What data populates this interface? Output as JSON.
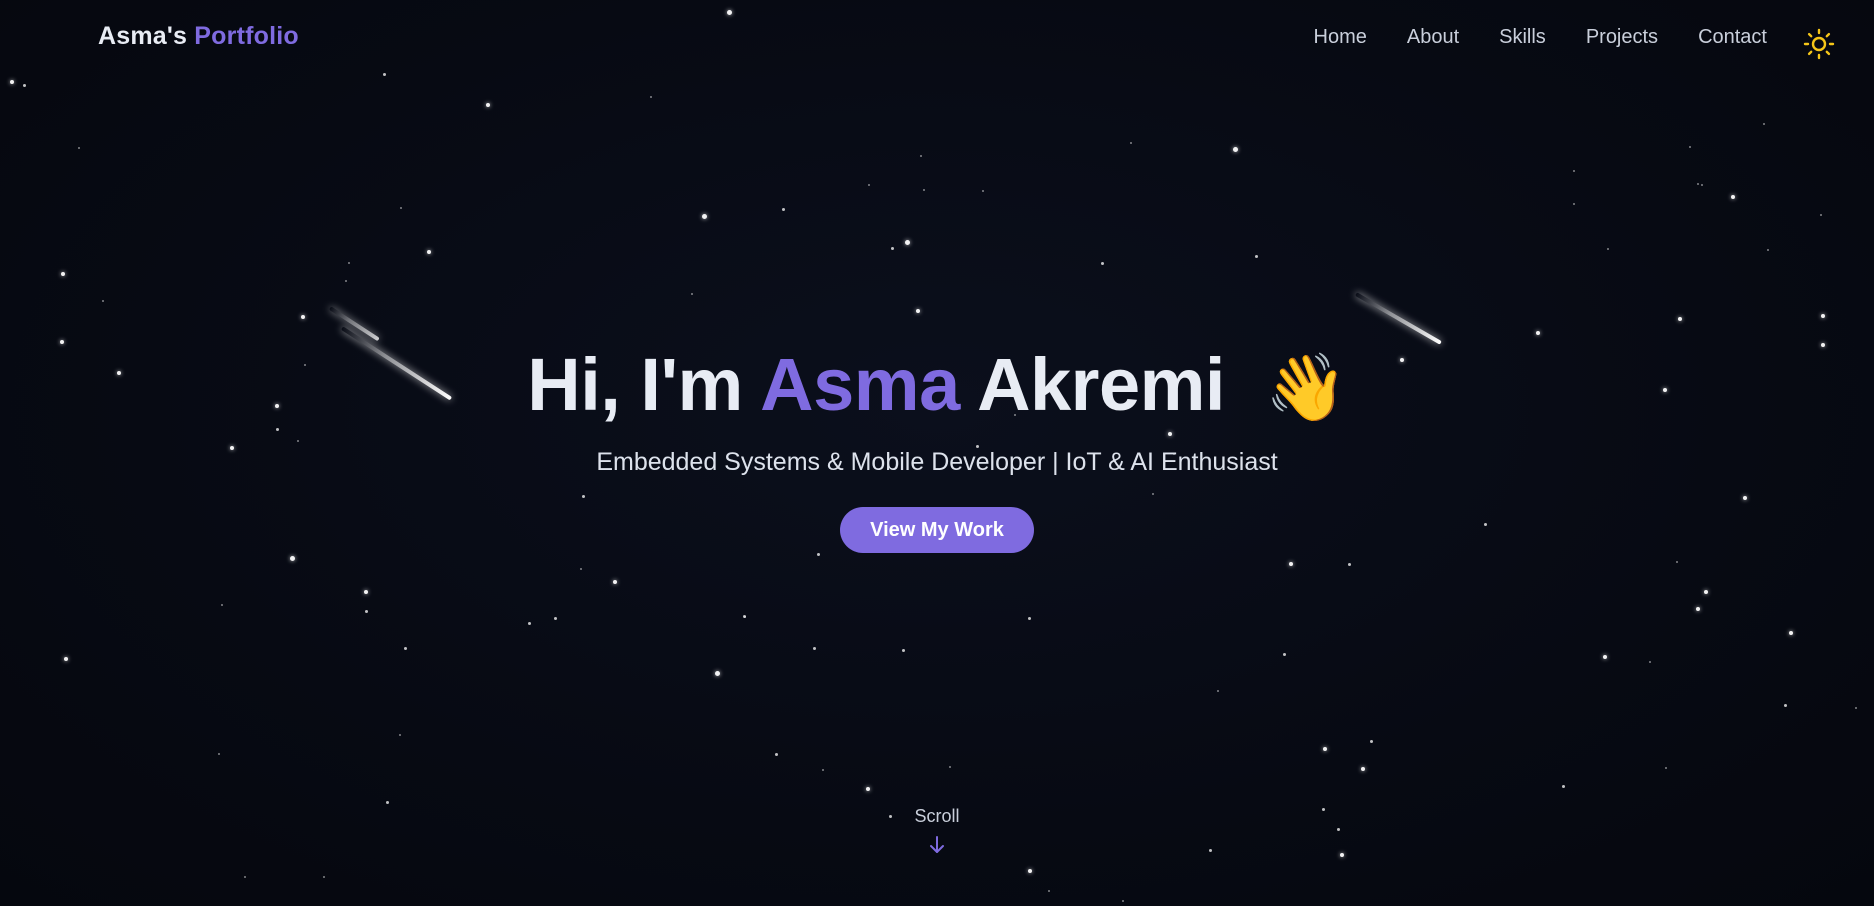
{
  "nav": {
    "brand_name": "Asma's",
    "brand_accent": "Portfolio",
    "links": [
      "Home",
      "About",
      "Skills",
      "Projects",
      "Contact"
    ],
    "theme_icon": "sun-icon"
  },
  "hero": {
    "greeting": "Hi, I'm",
    "first_name": "Asma",
    "last_name": "Akremi",
    "emoji": "👋",
    "subtitle": "Embedded Systems & Mobile Developer | IoT & AI Enthusiast",
    "cta_label": "View My Work"
  },
  "scroll": {
    "label": "Scroll",
    "icon": "arrow-down-icon"
  },
  "colors": {
    "background": "#070a13",
    "accent": "#7f6be0",
    "text": "#e8ecf4",
    "sun": "#f5c518"
  }
}
